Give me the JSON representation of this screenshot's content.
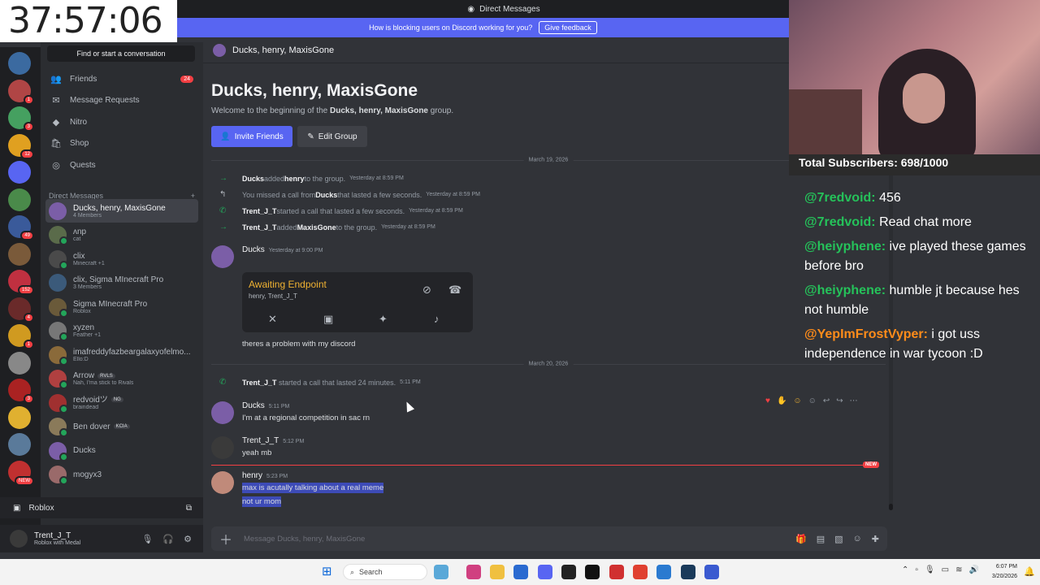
{
  "stream": {
    "timer": "37:57:06",
    "subscribers": "Total Subscribers: 698/1000",
    "chat": [
      {
        "user": "@7redvoid:",
        "text": "456",
        "color": "#25c25a"
      },
      {
        "user": "@7redvoid:",
        "text": "Read chat more",
        "color": "#25c25a"
      },
      {
        "user": "@heiyphene:",
        "text": "ive played these games before bro",
        "color": "#25c25a"
      },
      {
        "user": "@heiyphene:",
        "text": "humble jt because hes not humble",
        "color": "#25c25a"
      },
      {
        "user": "@YepImFrostVyper:",
        "text": "i got uss independence in war tycoon :D",
        "color": "#ff8c1a"
      }
    ]
  },
  "window": {
    "title": "Direct Messages"
  },
  "banner": {
    "text": "How is blocking users on Discord working for you?",
    "button": "Give feedback"
  },
  "sidebar": {
    "search": "Find or start a conversation",
    "nav": [
      {
        "label": "Friends",
        "icon": "friends-icon",
        "count": "24"
      },
      {
        "label": "Message Requests",
        "icon": "envelope-icon",
        "count": ""
      },
      {
        "label": "Nitro",
        "icon": "nitro-icon",
        "count": ""
      },
      {
        "label": "Shop",
        "icon": "shop-icon",
        "count": ""
      },
      {
        "label": "Quests",
        "icon": "quests-icon",
        "count": ""
      }
    ],
    "dm_header": "Direct Messages",
    "dms": [
      {
        "name": "Ducks, henry, MaxisGone",
        "sub": "4 Members",
        "color": "#7b5ea7",
        "active": true
      },
      {
        "name": "ʌnp",
        "sub": "cat",
        "color": "#5a6b4a"
      },
      {
        "name": "clix",
        "sub": "Minecraft +1",
        "color": "#4a4a4a"
      },
      {
        "name": "clix, Sigma MInecraft Pro",
        "sub": "3 Members",
        "color": "#3b5a7a"
      },
      {
        "name": "Sigma MInecraft Pro",
        "sub": "Roblox",
        "color": "#6a5a3a"
      },
      {
        "name": "xyzen",
        "sub": "Feather +1",
        "color": "#777777"
      },
      {
        "name": "imafreddyfazbeargalaxyofelmo...",
        "sub": "Ello:D",
        "color": "#8a6a3a"
      },
      {
        "name": "Arrow",
        "sub": "Nah, I'ma stick to Rivals",
        "color": "#b04040",
        "tag": "RVLS"
      },
      {
        "name": "redvoidツ",
        "sub": "braindead",
        "color": "#a03030",
        "tag": "NG"
      },
      {
        "name": "Ben dover",
        "sub": "",
        "color": "#8a7a5a",
        "tag": "KCIA"
      },
      {
        "name": "Ducks",
        "sub": "",
        "color": "#7b5ea7"
      },
      {
        "name": "mogyx3",
        "sub": "",
        "color": "#9a6a6a"
      }
    ],
    "game": "Roblox",
    "user": {
      "name": "Trent_J_T",
      "status": "Roblox with Medal"
    }
  },
  "server_rail": {
    "servers": [
      {
        "color": "#3b6aa0",
        "badge": ""
      },
      {
        "color": "#b04545",
        "badge": "1"
      },
      {
        "color": "#45a060",
        "badge": "3"
      },
      {
        "color": "#e0a020",
        "badge": "12"
      },
      {
        "color": "#5865f2",
        "badge": ""
      },
      {
        "color": "#4a8a4a",
        "badge": ""
      },
      {
        "color": "#3a5a9a",
        "badge": "49"
      },
      {
        "color": "#7a5a3a",
        "badge": ""
      },
      {
        "color": "#c03040",
        "badge": "152"
      },
      {
        "color": "#6a2a2a",
        "badge": "4"
      },
      {
        "color": "#d09a20",
        "badge": "1"
      },
      {
        "color": "#888888",
        "badge": ""
      },
      {
        "color": "#aa2222",
        "badge": "3"
      },
      {
        "color": "#e0b030",
        "badge": ""
      },
      {
        "color": "#5a7a9a",
        "badge": ""
      },
      {
        "color": "#c03030",
        "badge": "NEW"
      }
    ]
  },
  "chat": {
    "header": "Ducks, henry, MaxisGone",
    "welcome_title": "Ducks, henry, MaxisGone",
    "welcome_prefix": "Welcome to the beginning of the",
    "welcome_group": "Ducks, henry, MaxisGone",
    "welcome_suffix": "group.",
    "invite": "Invite Friends",
    "edit": "Edit Group",
    "date1": "March 19, 2026",
    "date2": "March 20, 2026",
    "sys": [
      {
        "a": "Ducks",
        "mid": "added",
        "b": "henry",
        "end": "to the group.",
        "ts": "Yesterday at 8:59 PM",
        "icon": "→",
        "cls": "green"
      },
      {
        "a": "You missed a call from",
        "mid": "",
        "b": "Ducks",
        "end": "that lasted a few seconds.",
        "ts": "Yesterday at 8:59 PM",
        "icon": "↰",
        "cls": "gray"
      },
      {
        "a": "Trent_J_T",
        "mid": "started a call that lasted a few seconds.",
        "b": "",
        "end": "",
        "ts": "Yesterday at 8:59 PM",
        "icon": "✆",
        "cls": "green"
      },
      {
        "a": "Trent_J_T",
        "mid": "added",
        "b": "MaxisGone",
        "end": "to the group.",
        "ts": "Yesterday at 8:59 PM",
        "icon": "→",
        "cls": "green"
      }
    ],
    "ducks_msg": {
      "author": "Ducks",
      "ts": "Yesterday at 9:00 PM",
      "text": "theres a problem with my discord"
    },
    "call_card": {
      "title": "Awaiting Endpoint",
      "who": "henry, Trent_J_T"
    },
    "sys_call2": {
      "a": "Trent_J_T",
      "mid": "started a call that lasted 24 minutes.",
      "ts": "5:11 PM"
    },
    "messages": [
      {
        "author": "Ducks",
        "ts": "5:11 PM",
        "lines": [
          "I'm at a regional competition in sac rn"
        ],
        "color": "#7b5ea7"
      },
      {
        "author": "Trent_J_T",
        "ts": "5:12 PM",
        "lines": [
          "yeah mb"
        ],
        "color": "#3a3a3a"
      },
      {
        "author": "henry",
        "ts": "5:23 PM",
        "lines": [
          "max is acutally talking about a real meme",
          "not ur mom"
        ],
        "color": "#c08a7a"
      }
    ],
    "new_tag": "NEW",
    "composer_placeholder": "Message Ducks, henry, MaxisGone"
  },
  "taskbar": {
    "search": "Search",
    "time": "6:07 PM",
    "date": "3/20/2026"
  }
}
